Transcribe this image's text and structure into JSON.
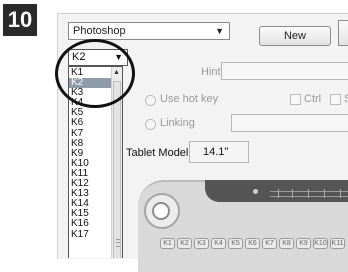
{
  "step_number": "10",
  "application_select": {
    "value": "Photoshop"
  },
  "new_button_label": "New",
  "key_select": {
    "value": "K2"
  },
  "key_list": {
    "items": [
      "K1",
      "K2",
      "K3",
      "K4",
      "K5",
      "K6",
      "K7",
      "K8",
      "K9",
      "K10",
      "K11",
      "K12",
      "K13",
      "K14",
      "K15",
      "K16",
      "K17"
    ],
    "selected": "K2"
  },
  "hint_label": "Hint:",
  "use_hot_key_label": "Use hot key",
  "ctrl_label": "Ctrl",
  "shift_label": "S",
  "linking_label": "Linking",
  "tablet_model_label": "Tablet Model:",
  "tablet_model_value": "14.1\"",
  "tablet_keys": [
    "K1",
    "K2",
    "K3",
    "K4",
    "K5",
    "K6",
    "K7",
    "K8",
    "K9",
    "K10",
    "K11"
  ]
}
